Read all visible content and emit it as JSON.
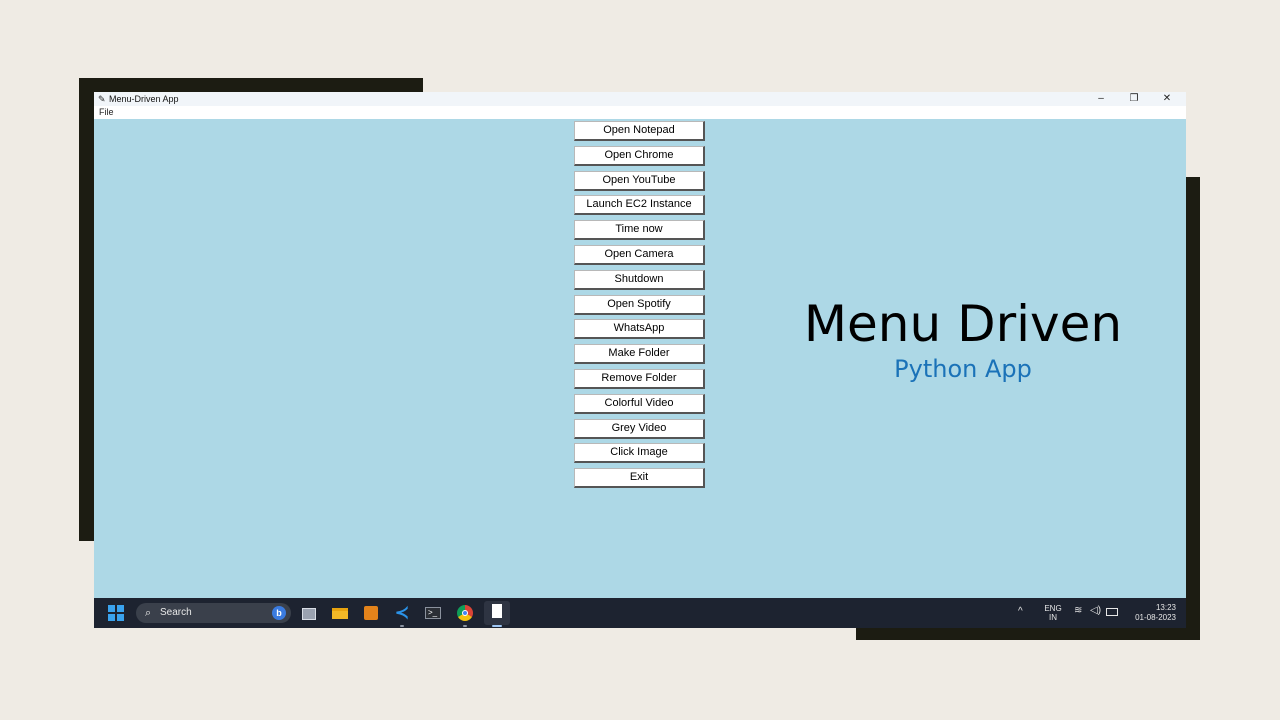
{
  "window": {
    "title": "Menu-Driven App",
    "icon": "feather-icon",
    "controls": {
      "minimize": "–",
      "maximize": "❐",
      "close": "✕"
    }
  },
  "menubar": {
    "file": "File"
  },
  "buttons": [
    "Open Notepad",
    "Open Chrome",
    "Open YouTube",
    "Launch EC2 Instance",
    "Time now",
    "Open Camera",
    "Shutdown",
    "Open Spotify",
    "WhatsApp",
    "Make Folder",
    "Remove Folder",
    "Colorful Video",
    "Grey Video",
    "Click Image",
    "Exit"
  ],
  "hero": {
    "title": "Menu Driven",
    "subtitle": "Python App"
  },
  "taskbar": {
    "search_placeholder": "Search",
    "bing_glyph": "b",
    "apps": [
      "task-view",
      "file-explorer",
      "sublime-text",
      "vscode",
      "terminal",
      "chrome",
      "notepad"
    ],
    "vscode_glyph": "≺",
    "terminal_glyph": ">_",
    "tray": {
      "chevron": "^",
      "lang_line1": "ENG",
      "lang_line2": "IN",
      "wifi": "≋",
      "volume": "◁)",
      "time": "13:23",
      "date": "01-08-2023"
    }
  },
  "colors": {
    "page_background": "#efebe4",
    "decor_blocks": "#1c1c12",
    "app_background": "#add8e6",
    "subtitle": "#1a72b8",
    "taskbar": "#1d2330"
  }
}
